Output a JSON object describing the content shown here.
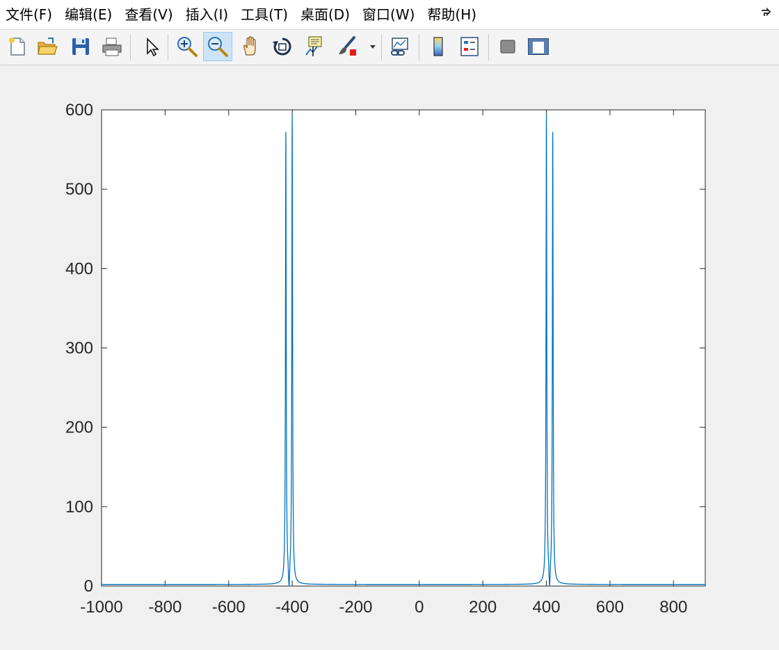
{
  "menubar": {
    "items": [
      {
        "label": "文件(F)"
      },
      {
        "label": "编辑(E)"
      },
      {
        "label": "查看(V)"
      },
      {
        "label": "插入(I)"
      },
      {
        "label": "工具(T)"
      },
      {
        "label": "桌面(D)"
      },
      {
        "label": "窗口(W)"
      },
      {
        "label": "帮助(H)"
      }
    ]
  },
  "toolbar": {
    "buttons": [
      {
        "icon": "new-figure-icon"
      },
      {
        "icon": "open-file-icon"
      },
      {
        "icon": "save-icon"
      },
      {
        "icon": "print-icon"
      },
      {
        "icon": "select-arrow-icon"
      },
      {
        "icon": "zoom-in-icon"
      },
      {
        "icon": "zoom-out-icon",
        "active": true
      },
      {
        "icon": "pan-hand-icon"
      },
      {
        "icon": "rotate-3d-icon"
      },
      {
        "icon": "data-cursor-icon"
      },
      {
        "icon": "brush-icon"
      },
      {
        "icon": "dropdown-arrow-icon"
      },
      {
        "icon": "link-plot-icon"
      },
      {
        "icon": "colorbar-icon"
      },
      {
        "icon": "legend-icon"
      },
      {
        "icon": "hide-plot-tools-icon"
      },
      {
        "icon": "show-plot-tools-icon"
      }
    ]
  },
  "chart_data": {
    "type": "line",
    "title": "",
    "xlabel": "",
    "ylabel": "",
    "xlim": [
      -1000,
      900
    ],
    "ylim": [
      0,
      600
    ],
    "xticks": [
      -1000,
      -800,
      -600,
      -400,
      -200,
      0,
      200,
      400,
      600,
      800
    ],
    "yticks": [
      0,
      100,
      200,
      300,
      400,
      500,
      600
    ],
    "grid": false,
    "line_color": "#0072bd",
    "peaks": [
      {
        "x": -420,
        "y": 567
      },
      {
        "x": -400,
        "y": 589
      },
      {
        "x": 400,
        "y": 589
      },
      {
        "x": 420,
        "y": 567
      }
    ],
    "notches": [
      -410,
      410
    ],
    "baseline": 2
  }
}
